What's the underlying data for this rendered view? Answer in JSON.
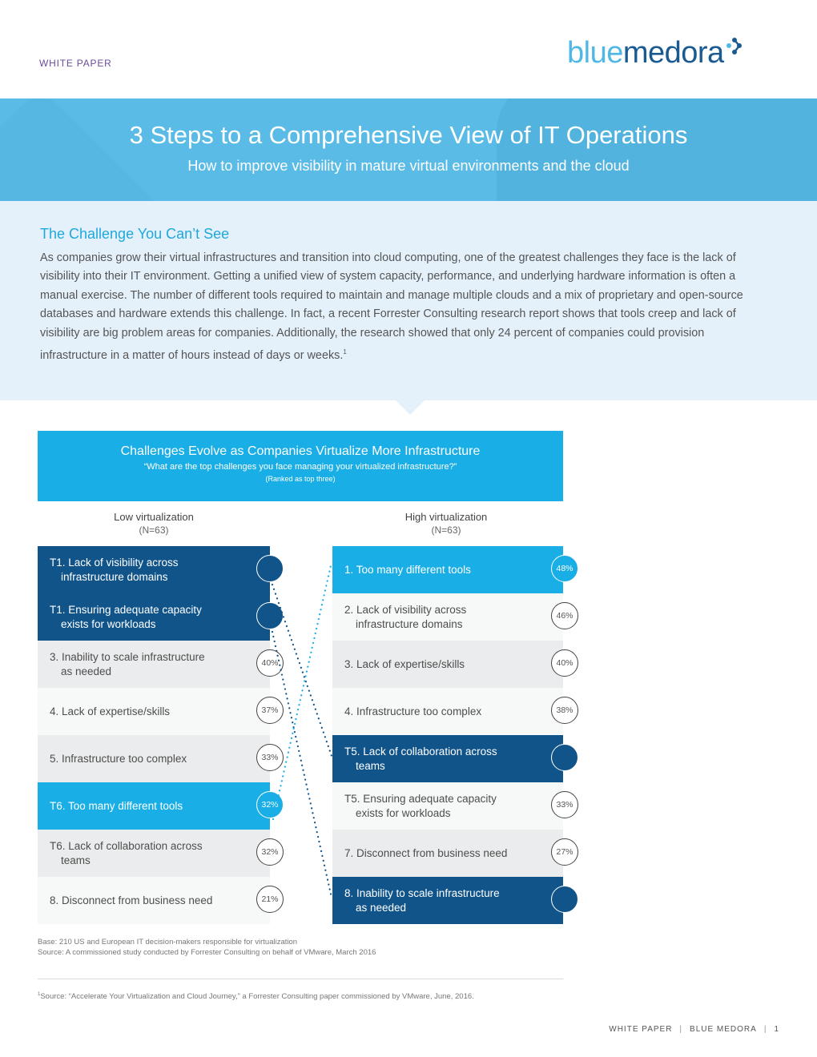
{
  "header": {
    "label": "WHITE PAPER",
    "logo": {
      "part1": "blue",
      "part2": "medora",
      "icon": "molecule-icon"
    }
  },
  "hero": {
    "title": "3 Steps to a Comprehensive View of IT Operations",
    "subtitle": "How to improve visibility in mature virtual environments and the cloud"
  },
  "challenge": {
    "heading": "The Challenge You Can’t See",
    "body": "As companies grow their virtual infrastructures and transition into cloud computing, one of the greatest challenges they face is the lack of visibility into their IT environment. Getting a unified view of system capacity, performance, and underlying hardware information is often a manual exercise. The number of different tools required to maintain and manage multiple clouds and a mix of proprietary and open-source databases and hardware extends this challenge. In fact, a recent Forrester Consulting research report shows that tools creep and lack of visibility are big problem areas for companies. Additionally, the research showed that only 24 percent of companies could provision infrastructure in a matter of hours instead of days or weeks.",
    "footnote_ref": "1"
  },
  "infographic": {
    "title": "Challenges Evolve as Companies Virtualize More Infrastructure",
    "question": "“What are the top challenges you face managing your virtualized infrastructure?”",
    "note": "(Ranked as top three)",
    "low": {
      "heading": "Low virtualization",
      "n": "(N=63)",
      "rows": [
        {
          "line1": "T1. Lack of visibility across",
          "line2": "infrastructure domains",
          "pct": "",
          "style": "dark"
        },
        {
          "line1": "T1. Ensuring adequate capacity",
          "line2": "exists for workloads",
          "pct": "",
          "style": "dark"
        },
        {
          "line1": "3. Inability to scale infrastructure",
          "line2": "as needed",
          "pct": "40%",
          "style": "grey"
        },
        {
          "line1": "4. Lack of expertise/skills",
          "line2": "",
          "pct": "37%",
          "style": "white"
        },
        {
          "line1": "5. Infrastructure too complex",
          "line2": "",
          "pct": "33%",
          "style": "grey"
        },
        {
          "line1": "T6. Too many different tools",
          "line2": "",
          "pct": "32%",
          "style": "light"
        },
        {
          "line1": "T6. Lack of collaboration across",
          "line2": "teams",
          "pct": "32%",
          "style": "grey"
        },
        {
          "line1": "8. Disconnect from business need",
          "line2": "",
          "pct": "21%",
          "style": "white"
        }
      ]
    },
    "high": {
      "heading": "High virtualization",
      "n": "(N=63)",
      "rows": [
        {
          "line1": "1. Too many different tools",
          "line2": "",
          "pct": "48%",
          "style": "light"
        },
        {
          "line1": "2. Lack of visibility across",
          "line2": "infrastructure domains",
          "pct": "46%",
          "style": "white"
        },
        {
          "line1": "3. Lack of expertise/skills",
          "line2": "",
          "pct": "40%",
          "style": "grey"
        },
        {
          "line1": "4. Infrastructure too complex",
          "line2": "",
          "pct": "38%",
          "style": "white"
        },
        {
          "line1": "T5. Lack of collaboration across",
          "line2": "teams",
          "pct": "",
          "style": "dark"
        },
        {
          "line1": "T5. Ensuring adequate capacity",
          "line2": "exists for workloads",
          "pct": "33%",
          "style": "white"
        },
        {
          "line1": "7. Disconnect from business need",
          "line2": "",
          "pct": "27%",
          "style": "grey"
        },
        {
          "line1": "8. Inability to scale infrastructure",
          "line2": "as needed",
          "pct": "",
          "style": "dark"
        }
      ]
    },
    "connectors": [
      {
        "from_low": 0,
        "to_high": 4,
        "color": "#11548a"
      },
      {
        "from_low": 1,
        "to_high": 7,
        "color": "#11548a"
      },
      {
        "from_low": 5,
        "to_high": 0,
        "color": "#1aaee6"
      }
    ],
    "base": "Base: 210 US and European IT decision-makers responsible for virtualization",
    "source": "Source: A commissioned study conducted by Forrester Consulting on behalf of VMware, March 2016"
  },
  "footnote": {
    "marker": "1",
    "text": "Source: “Accelerate Your Virtualization and Cloud Journey,” a Forrester Consulting paper commissioned by VMware, June, 2016."
  },
  "footer": {
    "left": "WHITE PAPER",
    "middle": "BLUE MEDORA",
    "page": "1"
  }
}
